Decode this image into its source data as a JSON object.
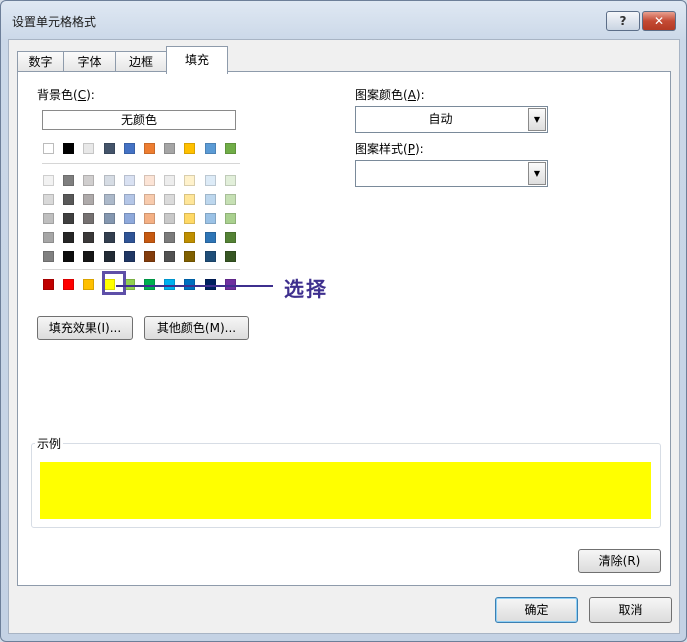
{
  "window": {
    "title": "设置单元格格式",
    "help_label": "?",
    "close_label": "✕"
  },
  "tabs": [
    {
      "label": "数字",
      "active": false
    },
    {
      "label": "字体",
      "active": false
    },
    {
      "label": "边框",
      "active": false
    },
    {
      "label": "填充",
      "active": true
    }
  ],
  "background": {
    "label": "背景色",
    "hotkey": "C",
    "no_color_label": "无颜色",
    "selected_color": "#ffff00",
    "theme_row": [
      "#ffffff",
      "#000000",
      "#e8e8e8",
      "#44546a",
      "#4472c4",
      "#ed7d31",
      "#a5a5a5",
      "#ffc000",
      "#5b9bd5",
      "#70ad47"
    ],
    "tint_rows": [
      [
        "#f2f2f2",
        "#7f7f7f",
        "#d0cece",
        "#d6dce4",
        "#d9e1f2",
        "#fce4d6",
        "#ededed",
        "#fff2cc",
        "#ddebf7",
        "#e2efda"
      ],
      [
        "#d9d9d9",
        "#595959",
        "#aeaaaa",
        "#acb9ca",
        "#b4c6e7",
        "#f8cbad",
        "#dbdbdb",
        "#ffe699",
        "#bdd7ee",
        "#c6e0b4"
      ],
      [
        "#bfbfbf",
        "#404040",
        "#757171",
        "#8497b0",
        "#8ea9db",
        "#f4b084",
        "#c9c9c9",
        "#ffd966",
        "#9bc2e6",
        "#a9d08e"
      ],
      [
        "#a6a6a6",
        "#262626",
        "#3a3838",
        "#333f4f",
        "#2f5496",
        "#c65911",
        "#7b7b7b",
        "#bf8f00",
        "#2e75b6",
        "#548235"
      ],
      [
        "#808080",
        "#0d0d0d",
        "#161616",
        "#222b35",
        "#203764",
        "#833c0c",
        "#525252",
        "#806000",
        "#1f4e78",
        "#375623"
      ]
    ],
    "standard_row": [
      "#c00000",
      "#ff0000",
      "#ffc000",
      "#ffff00",
      "#92d050",
      "#00b050",
      "#00b0f0",
      "#0070c0",
      "#002060",
      "#7030a0"
    ],
    "fill_effects_label": "填充效果(I)...",
    "more_colors_label": "其他颜色(M)..."
  },
  "callout": {
    "text": "选择"
  },
  "pattern": {
    "color_label": "图案颜色",
    "color_hotkey": "A",
    "color_value": "自动",
    "style_label": "图案样式",
    "style_hotkey": "P",
    "style_value": ""
  },
  "sample": {
    "label": "示例"
  },
  "buttons": {
    "clear": "清除(R)",
    "ok": "确定",
    "cancel": "取消"
  }
}
